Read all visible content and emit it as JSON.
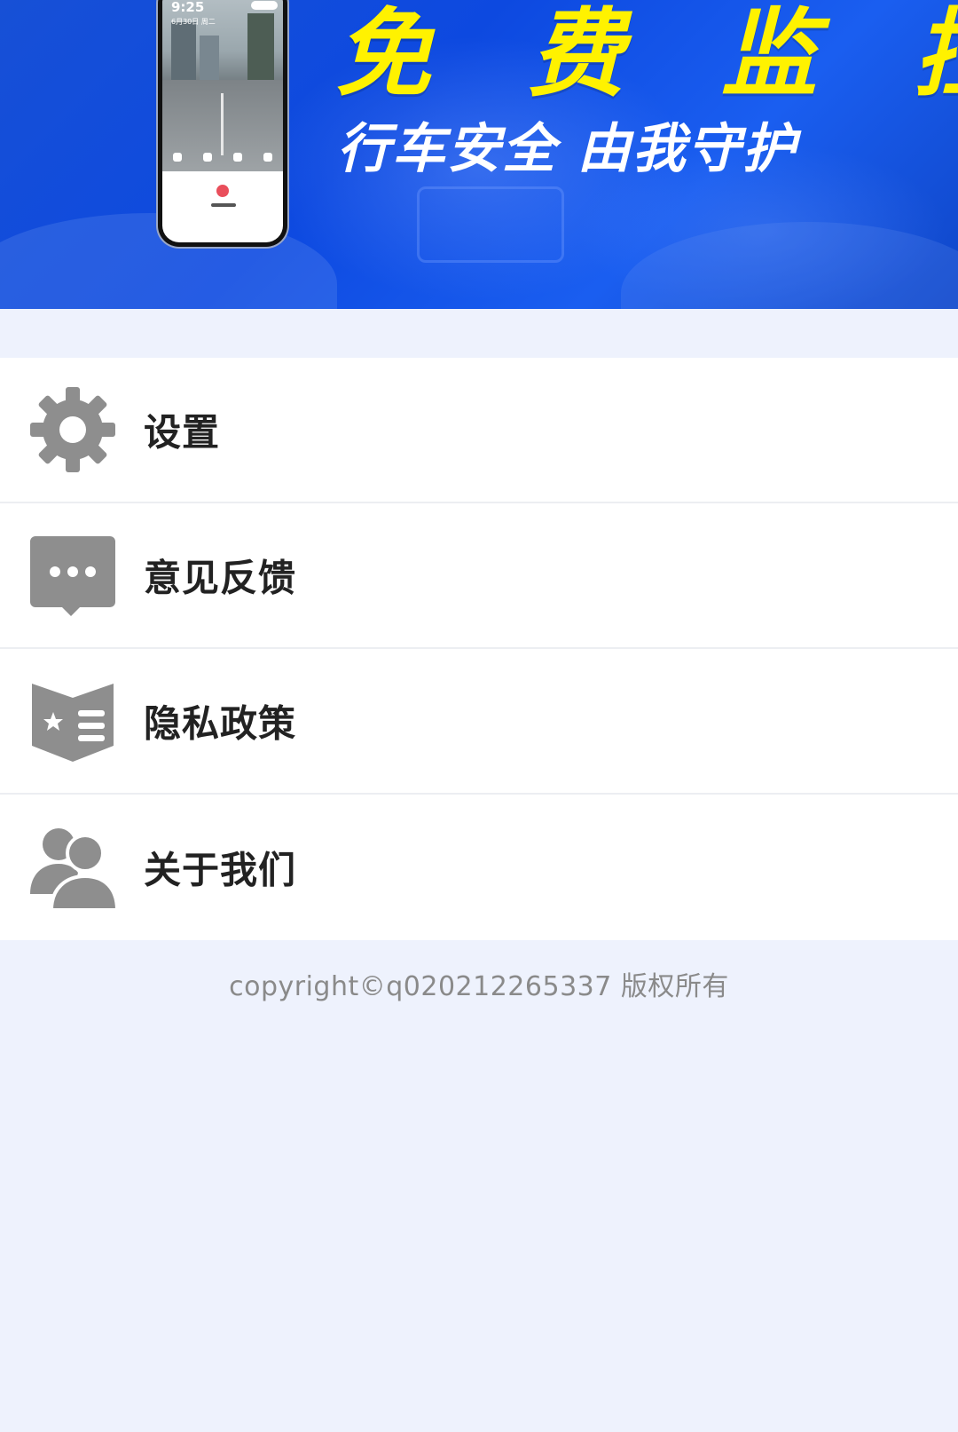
{
  "banner": {
    "title": "免 费 监 控",
    "subtitle": "行车安全 由我守护",
    "title_color": "#fff200",
    "background_color": "#1750d6",
    "phone_mockup": {
      "time": "9:25",
      "date": "6月30日 周二"
    }
  },
  "menu": {
    "items": [
      {
        "label": "设置",
        "icon": "gear-icon"
      },
      {
        "label": "意见反馈",
        "icon": "chat-bubble-icon"
      },
      {
        "label": "隐私政策",
        "icon": "policy-book-icon"
      },
      {
        "label": "关于我们",
        "icon": "users-icon"
      }
    ]
  },
  "footer": {
    "copyright": "copyright©q020212265337 版权所有"
  },
  "colors": {
    "page_background": "#eef2fd",
    "icon_gray": "#8e8e8e",
    "label_text": "#222222",
    "footer_text": "#8a8a8a"
  }
}
